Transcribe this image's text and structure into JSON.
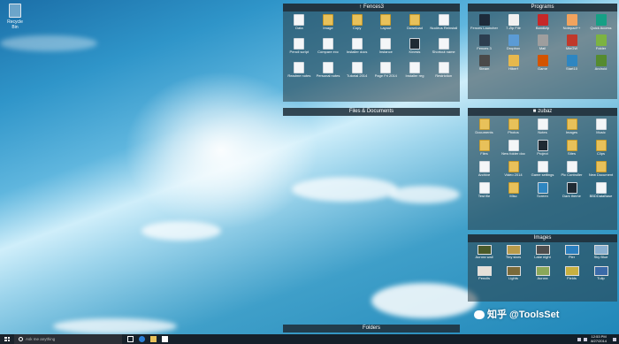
{
  "desktop": {
    "recycle_bin_label": "Recycle Bin"
  },
  "fences": {
    "fences3": {
      "title": "Fences3",
      "items": [
        {
          "label": "Data",
          "kind": "doc"
        },
        {
          "label": "Image",
          "kind": "folder"
        },
        {
          "label": "Copy",
          "kind": "folder"
        },
        {
          "label": "Layout",
          "kind": "folder"
        },
        {
          "label": "Download",
          "kind": "folder"
        },
        {
          "label": "Nucleus Reinstall",
          "kind": "doc"
        },
        {
          "label": "Pencil script",
          "kind": "doc"
        },
        {
          "label": "Compare exc",
          "kind": "doc"
        },
        {
          "label": "Installer docs",
          "kind": "doc"
        },
        {
          "label": "Instance",
          "kind": "doc"
        },
        {
          "label": "Kinesis",
          "kind": "dark"
        },
        {
          "label": "Shortcut name",
          "kind": "doc"
        },
        {
          "label": "Readme notes",
          "kind": "doc"
        },
        {
          "label": "Personal notes",
          "kind": "doc"
        },
        {
          "label": "Tutorial 2014",
          "kind": "doc"
        },
        {
          "label": "Page Fri 2014",
          "kind": "doc"
        },
        {
          "label": "Installer reg",
          "kind": "doc"
        },
        {
          "label": "Restriction",
          "kind": "doc"
        }
      ]
    },
    "files_documents": {
      "title": "Files & Documents"
    },
    "programs": {
      "title": "Programs",
      "items": [
        {
          "label": "Fences Launcher",
          "color": "#1d2a3a"
        },
        {
          "label": "7-Zip File",
          "color": "#f0f0f0"
        },
        {
          "label": "Bandizip",
          "color": "#c62828"
        },
        {
          "label": "Notepad++",
          "color": "#f2a35e"
        },
        {
          "label": "Quick Access",
          "color": "#16a085"
        },
        {
          "label": "Fences 3",
          "color": "#2c3e50"
        },
        {
          "label": "Dropbox",
          "color": "#5b9bd5"
        },
        {
          "label": "Mail",
          "color": "#9e9e9e"
        },
        {
          "label": "MinGW",
          "color": "#c0392b"
        },
        {
          "label": "Folder",
          "color": "#7cb342"
        },
        {
          "label": "Steam",
          "color": "#4a4a4a"
        },
        {
          "label": "Hiberf",
          "color": "#e6b84d"
        },
        {
          "label": "Game",
          "color": "#d35400"
        },
        {
          "label": "Start10",
          "color": "#2e86c1"
        },
        {
          "label": "Android",
          "color": "#558b2f"
        }
      ]
    },
    "zubaz": {
      "title": "zubaz",
      "items": [
        {
          "label": "Documents",
          "kind": "folder"
        },
        {
          "label": "Photos",
          "kind": "folder"
        },
        {
          "label": "Notes",
          "kind": "doc"
        },
        {
          "label": "Images",
          "kind": "folder"
        },
        {
          "label": "Music",
          "kind": "doc"
        },
        {
          "label": "Files",
          "kind": "folder"
        },
        {
          "label": "New folder doc",
          "kind": "doc"
        },
        {
          "label": "Project",
          "kind": "dark"
        },
        {
          "label": "Sites",
          "kind": "folder"
        },
        {
          "label": "Clips",
          "kind": "folder"
        },
        {
          "label": "Archive",
          "kind": "doc"
        },
        {
          "label": "Video 2014",
          "kind": "folder"
        },
        {
          "label": "Game settings",
          "kind": "doc"
        },
        {
          "label": "Pic Controller",
          "kind": "doc"
        },
        {
          "label": "New Document",
          "kind": "folder"
        },
        {
          "label": "Test file",
          "kind": "doc"
        },
        {
          "label": "Misc",
          "kind": "folder"
        },
        {
          "label": "Screen",
          "kind": "blue"
        },
        {
          "label": "Dark theme",
          "kind": "dark"
        },
        {
          "label": "BBDDataBase",
          "kind": "doc"
        }
      ]
    },
    "images": {
      "title": "Images",
      "items": [
        {
          "label": "Aurora wall",
          "color": "#4a5a2a"
        },
        {
          "label": "Tiny stars",
          "color": "#b89a4a"
        },
        {
          "label": "Lake night",
          "color": "#4e4e4e"
        },
        {
          "label": "Pier",
          "color": "#2b7fbf"
        },
        {
          "label": "Sky Blue",
          "color": "#8ab0d0"
        },
        {
          "label": "Pencils",
          "color": "#e6e0d8"
        },
        {
          "label": "Lights",
          "color": "#7a6a3a"
        },
        {
          "label": "Aurora",
          "color": "#8aa75a"
        },
        {
          "label": "Fields",
          "color": "#c8b040"
        },
        {
          "label": "Tulip",
          "color": "#3a6aa8"
        }
      ]
    },
    "folders": {
      "title": "Folders"
    }
  },
  "taskbar": {
    "search_placeholder": "Ask me anything",
    "clock_time": "12:53 PM",
    "clock_date": "8/27/2014"
  },
  "watermark": "知乎 @ToolsSet"
}
